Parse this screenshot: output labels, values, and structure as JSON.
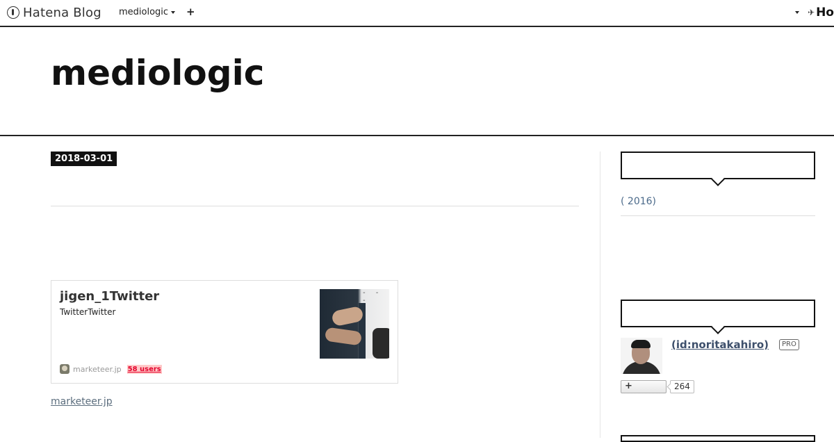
{
  "topbar": {
    "logo_text": "Hatena Blog",
    "blog_menu_label": "mediologic",
    "add_label": "+",
    "right_logo_text": "Ho"
  },
  "header": {
    "site_title": "mediologic"
  },
  "entry": {
    "date": "2018-03-01",
    "embed": {
      "title": "jigen_1Twitter",
      "description": "TwitterTwitter",
      "domain": "marketeer.jp",
      "bookmark_count": "58 users"
    },
    "source_link": "marketeer.jp"
  },
  "sidebar": {
    "archive_item": "( 2016)",
    "profile": {
      "author_link": " (id:noritakahiro)",
      "badge": "PRO",
      "subscribe_icon": "+",
      "subscriber_count": "264"
    }
  }
}
